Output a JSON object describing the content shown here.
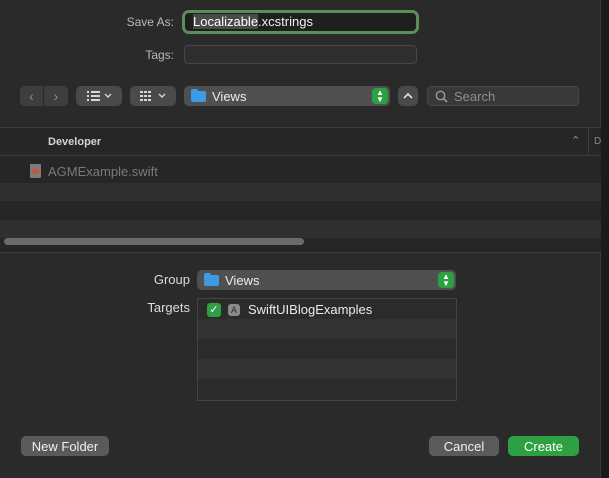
{
  "save_as": {
    "label": "Save As:",
    "name_selected": "Localizable",
    "name_ext": ".xcstrings"
  },
  "tags": {
    "label": "Tags:"
  },
  "toolbar": {
    "back_icon": "chevron-left-icon",
    "forward_icon": "chevron-right-icon",
    "list_view_icon": "list-icon",
    "grid_view_icon": "grid-icon",
    "location": "Views",
    "search_placeholder": "Search"
  },
  "browser": {
    "column_header": "Developer",
    "files": [
      {
        "name": "AGMExample.swift",
        "icon": "swift-file-icon",
        "enabled": false
      }
    ]
  },
  "group": {
    "label": "Group",
    "value": "Views"
  },
  "targets": {
    "label": "Targets",
    "items": [
      {
        "name": "SwiftUIBlogExamples",
        "checked": true,
        "icon": "app-target-icon"
      }
    ]
  },
  "buttons": {
    "new_folder": "New Folder",
    "cancel": "Cancel",
    "create": "Create"
  },
  "colors": {
    "accent_green": "#2ea043",
    "folder_blue": "#3d9be6",
    "focus_ring": "#5b8f5a"
  }
}
